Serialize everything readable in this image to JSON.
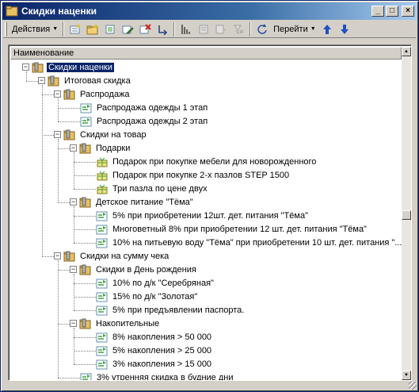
{
  "window": {
    "title": "Скидки наценки"
  },
  "title_buttons": {
    "minimize": "_",
    "maximize": "□",
    "close": "×"
  },
  "toolbar": {
    "actions_label": "Действия",
    "goto_label": "Перейти"
  },
  "table": {
    "column_header": "Наименование"
  },
  "tree": [
    {
      "label": "Скидки наценки",
      "level": 0,
      "type": "folder",
      "expanded": true,
      "selected": true
    },
    {
      "label": "Итоговая скидка",
      "level": 1,
      "type": "folder",
      "expanded": true
    },
    {
      "label": "Распродажа",
      "level": 2,
      "type": "folder",
      "expanded": true
    },
    {
      "label": "Распродажа одежды 1 этап",
      "level": 3,
      "type": "item"
    },
    {
      "label": "Распродажа одежды 2 этап",
      "level": 3,
      "type": "item"
    },
    {
      "label": "Скидки на товар",
      "level": 2,
      "type": "folder",
      "expanded": true
    },
    {
      "label": "Подарки",
      "level": 3,
      "type": "folder",
      "expanded": true
    },
    {
      "label": "Подарок при покупке мебели для новорожденного",
      "level": 4,
      "type": "gift"
    },
    {
      "label": "Подарок при покупке 2-х пазлов STEP 1500",
      "level": 4,
      "type": "gift"
    },
    {
      "label": "Три пазла по цене двух",
      "level": 4,
      "type": "gift"
    },
    {
      "label": "Детское питание \"Тёма\"",
      "level": 3,
      "type": "folder",
      "expanded": true
    },
    {
      "label": "5% при приобретении 12шт. дет. питания \"Тёма\"",
      "level": 4,
      "type": "item"
    },
    {
      "label": "Многоветный 8% при приобретении 12 шт. дет. питания \"Тёма\"",
      "level": 4,
      "type": "item"
    },
    {
      "label": "10% на питьевую воду \"Тёма\" при приобретении 10 шт. дет. питания \"...",
      "level": 4,
      "type": "item"
    },
    {
      "label": "Скидки на сумму чека",
      "level": 2,
      "type": "folder",
      "expanded": true
    },
    {
      "label": "Скидки в День рождения",
      "level": 3,
      "type": "folder",
      "expanded": true
    },
    {
      "label": "10% по д/к \"Серебряная\"",
      "level": 4,
      "type": "item"
    },
    {
      "label": "15% по д/к \"Золотая\"",
      "level": 4,
      "type": "item"
    },
    {
      "label": "5% при предъявлении паспорта.",
      "level": 4,
      "type": "item"
    },
    {
      "label": "Накопительные",
      "level": 3,
      "type": "folder",
      "expanded": true
    },
    {
      "label": "8%  накопления > 50 000",
      "level": 4,
      "type": "item"
    },
    {
      "label": "5%  накопления > 25 000",
      "level": 4,
      "type": "item"
    },
    {
      "label": "3%  накопления > 15 000",
      "level": 4,
      "type": "item"
    },
    {
      "label": "3% утренняя скидка в будние дни",
      "level": 3,
      "type": "item"
    }
  ]
}
